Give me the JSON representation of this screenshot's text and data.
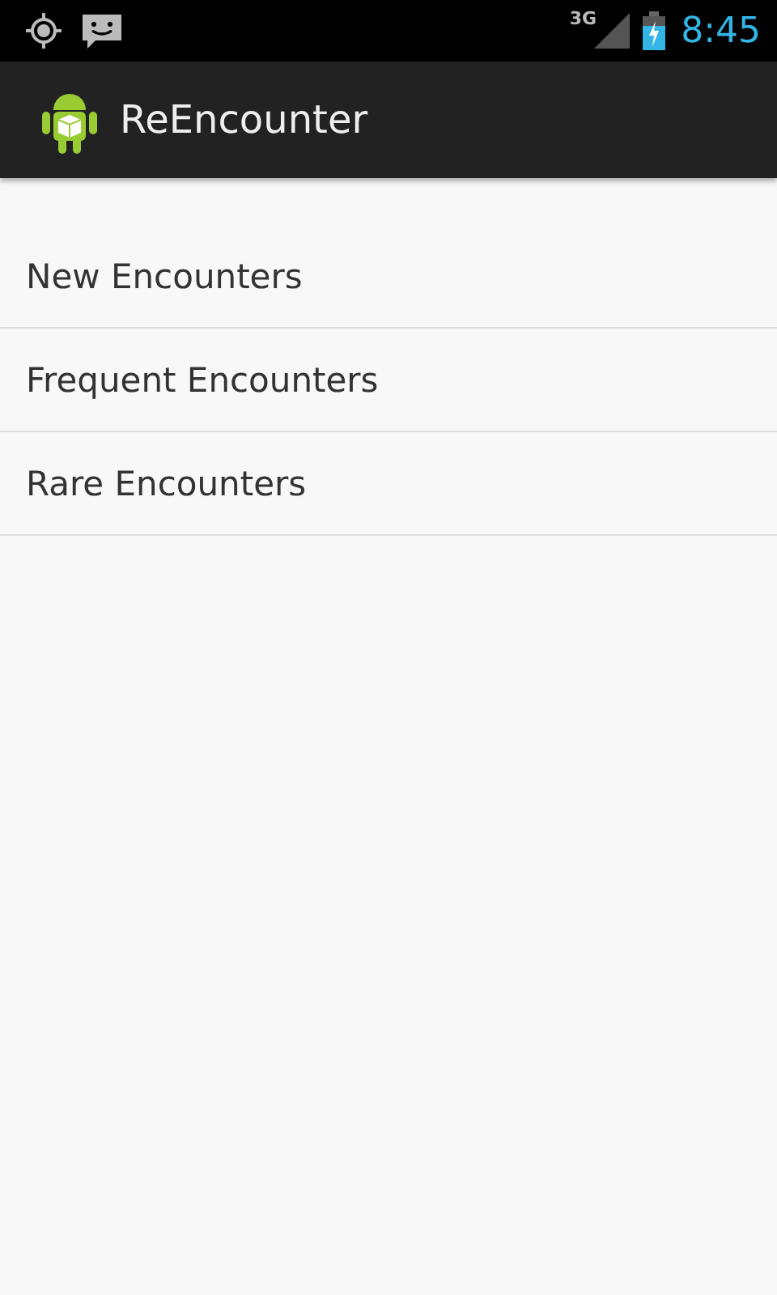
{
  "status_bar": {
    "network": "3G",
    "time": "8:45"
  },
  "action_bar": {
    "title": "ReEncounter"
  },
  "list": {
    "items": [
      {
        "label": "New Encounters"
      },
      {
        "label": "Frequent Encounters"
      },
      {
        "label": "Rare Encounters"
      }
    ]
  }
}
